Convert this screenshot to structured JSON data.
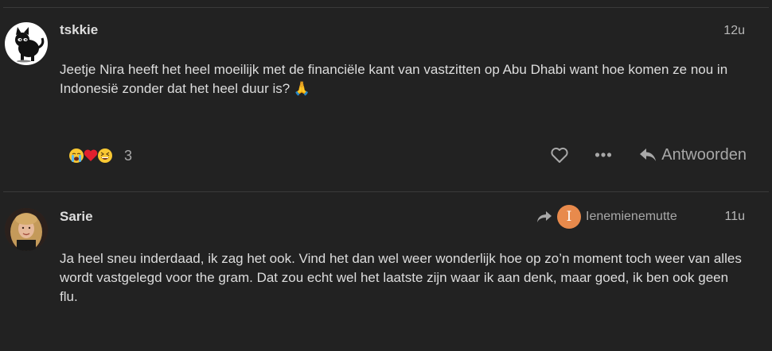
{
  "posts": [
    {
      "username": "tskkie",
      "age": "12u",
      "avatar_icon": "black-cat-avatar-icon",
      "body": "Jeetje Nira heeft het heel moeilijk met de financiële kant van vastzitten op Abu Dhabi want hoe komen ze nou in Indonesië zonder dat het heel duur is? 🙏",
      "reactions": {
        "emojis": [
          "loudly-crying-face",
          "red-heart",
          "grinning-squinting-face"
        ],
        "count": "3"
      },
      "actions": {
        "like_icon": "heart-outline-icon",
        "more_icon": "ellipsis-icon",
        "reply_icon": "reply-arrow-icon",
        "reply_label": "Antwoorden"
      }
    },
    {
      "username": "Sarie",
      "age": "11u",
      "avatar_icon": "user-photo-avatar",
      "reply_to": {
        "icon": "reply-arrow-icon",
        "avatar_letter": "I",
        "avatar_color": "#e88a4c",
        "username": "Ienemienemutte"
      },
      "body": "Ja heel sneu inderdaad, ik zag het ook. Vind het dan wel weer wonderlijk hoe op zo’n moment toch weer van alles wordt vastgelegd voor the gram. Dat zou echt wel het laatste zijn waar ik aan denk, maar goed, ik ben ook geen flu."
    }
  ]
}
